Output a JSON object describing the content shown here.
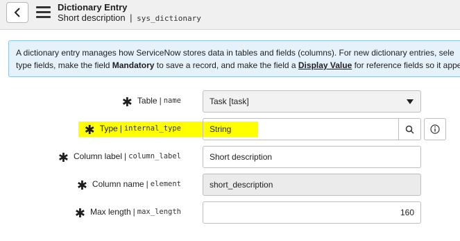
{
  "header": {
    "title": "Dictionary Entry",
    "subtitle": "Short description",
    "table": "sys_dictionary"
  },
  "info": {
    "line1": "A dictionary entry manages how ServiceNow stores data in tables and fields (columns). For new dictionary entries, sele",
    "line2_part1": "type fields, make the field ",
    "mandatory": "Mandatory",
    "line2_part2": " to save a record, and make the field a ",
    "display_value": "Display Value",
    "line2_part3": " for reference fields so it appea"
  },
  "form": {
    "table": {
      "label": "Table",
      "field": "name",
      "value": "Task [task]"
    },
    "type": {
      "label": "Type",
      "field": "internal_type",
      "value": "String"
    },
    "column_label": {
      "label": "Column label",
      "field": "column_label",
      "value": "Short description"
    },
    "column_name": {
      "label": "Column name",
      "field": "element",
      "value": "short_description"
    },
    "max_length": {
      "label": "Max length",
      "field": "max_length",
      "value": "160"
    }
  },
  "colors": {
    "highlight": "#ffff00",
    "info_bg": "#e6f2fb",
    "info_border": "#8ec2e6"
  },
  "icons": [
    "chevron-left-icon",
    "hamburger-menu-icon",
    "required-asterisk-icon",
    "dropdown-caret-icon",
    "search-icon",
    "info-icon"
  ]
}
